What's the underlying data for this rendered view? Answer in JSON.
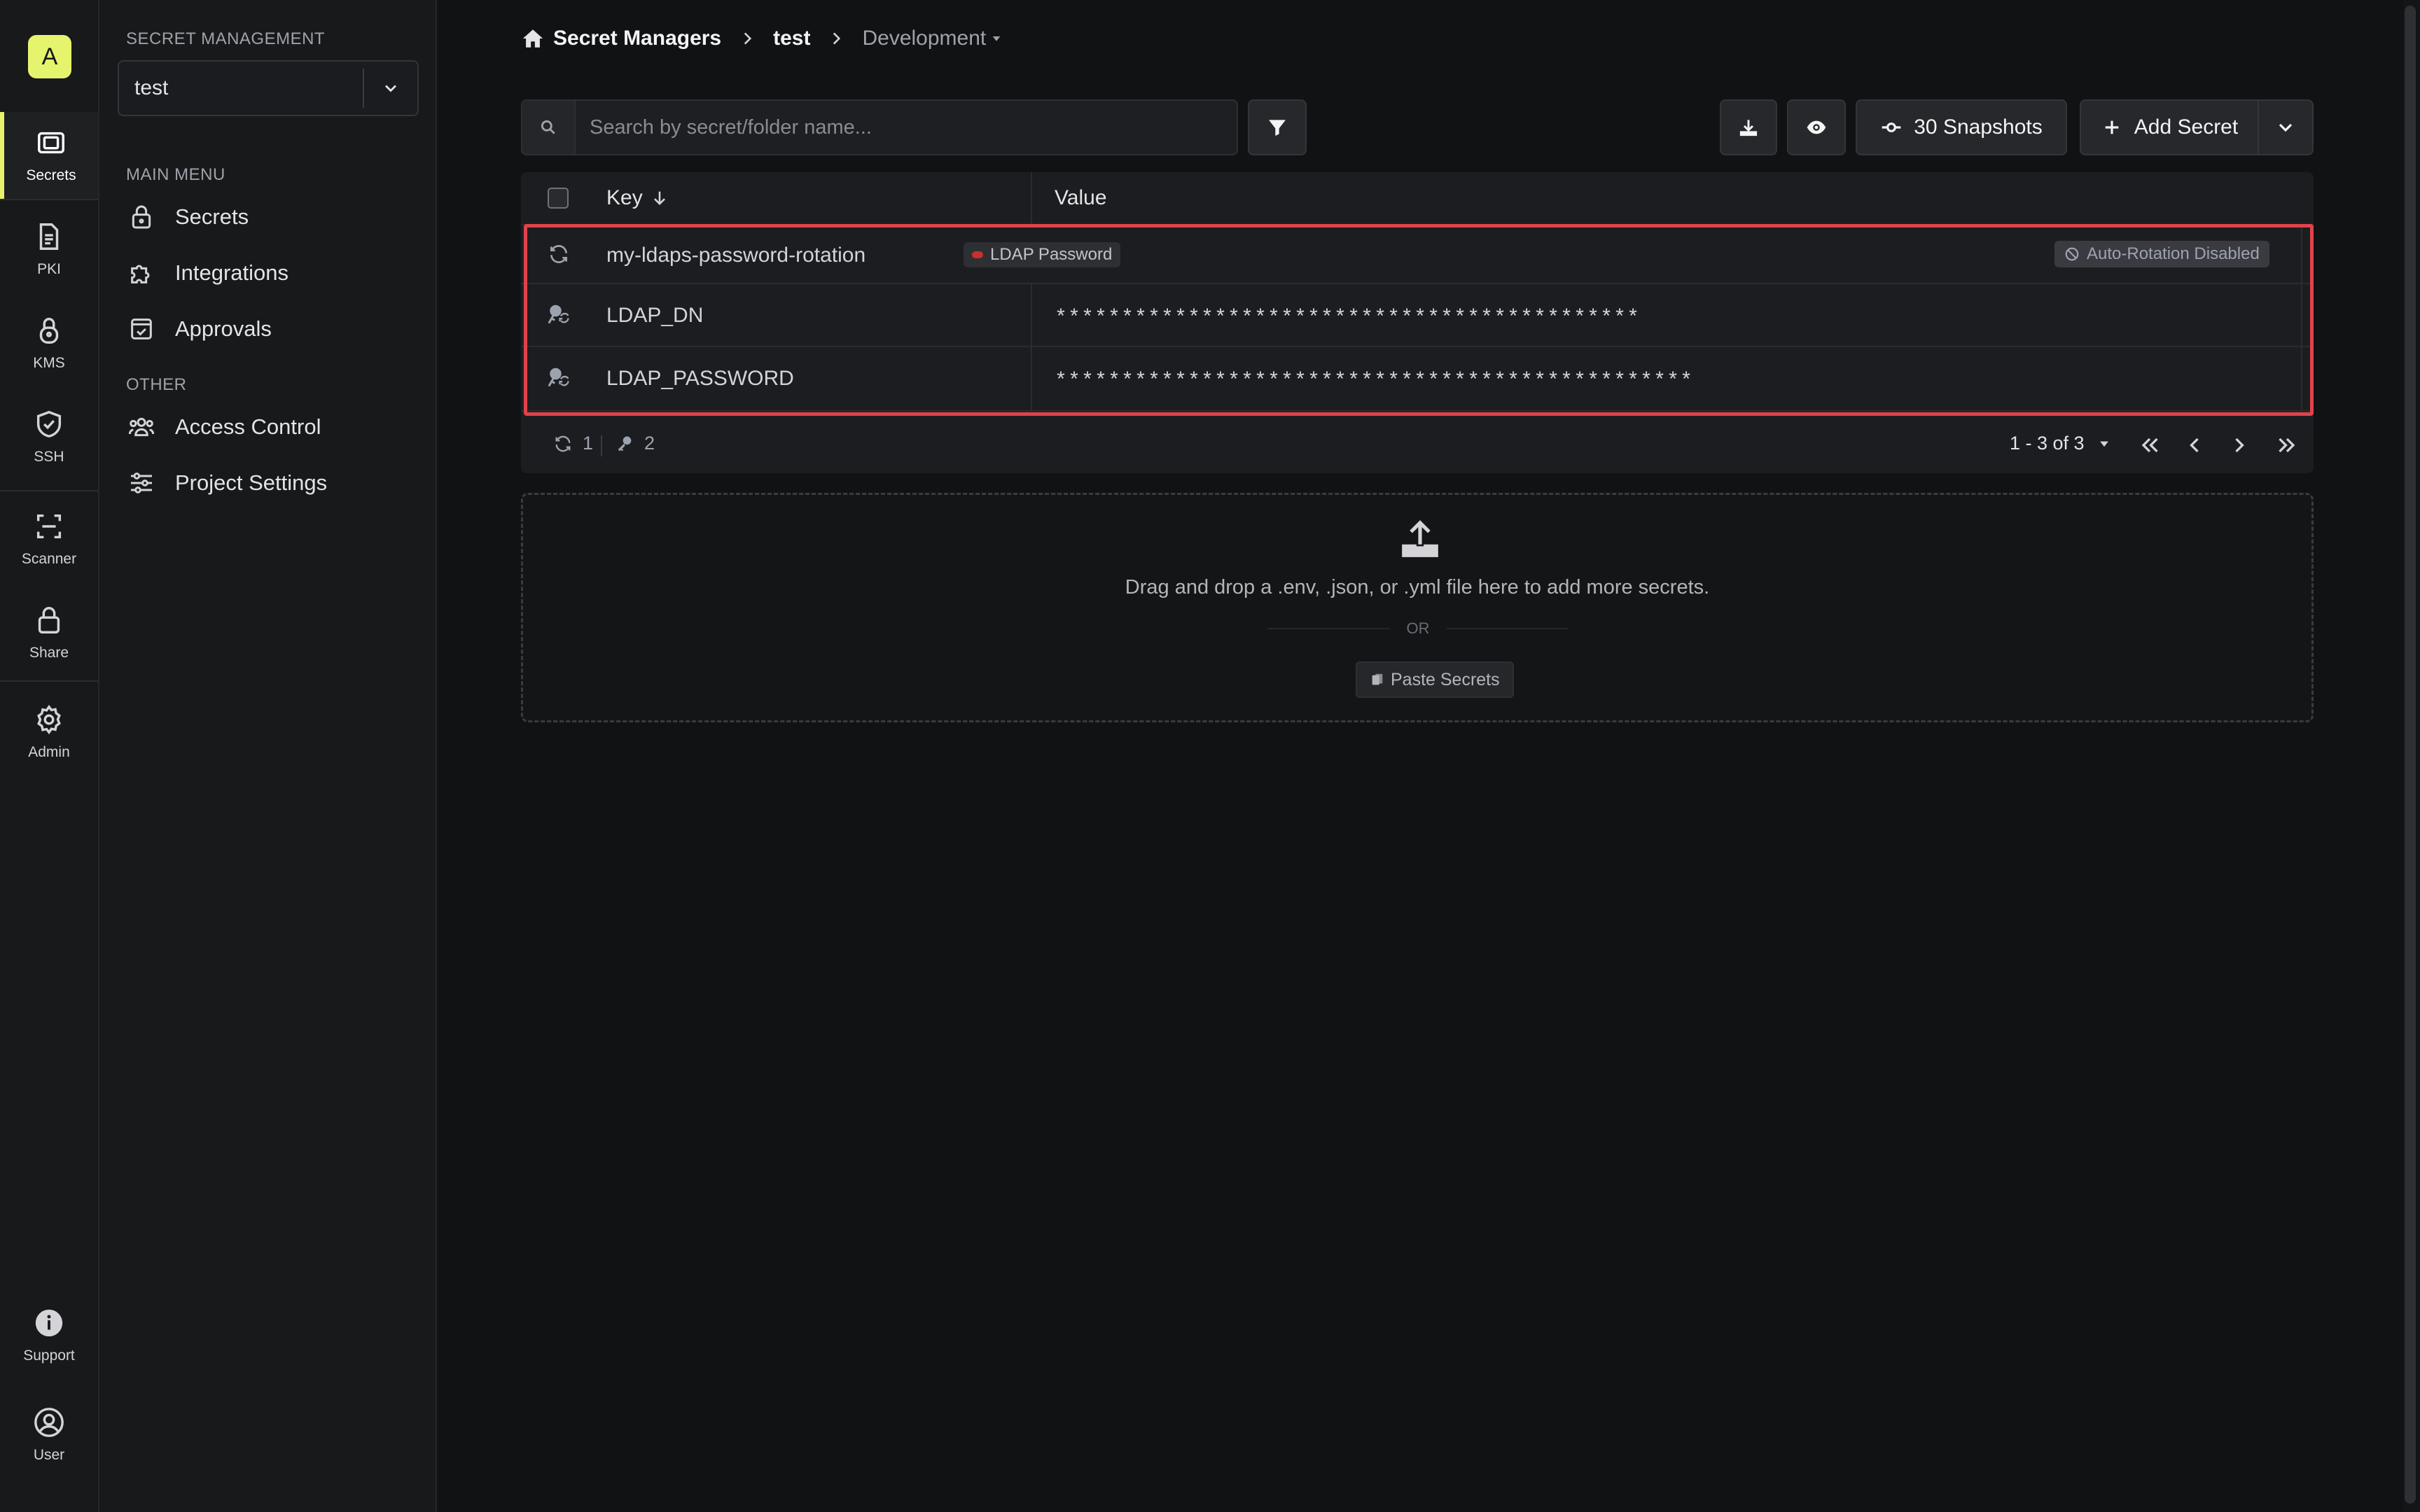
{
  "rail": {
    "avatar_letter": "A",
    "items": [
      {
        "label": "Secrets",
        "icon": "vault-icon"
      },
      {
        "label": "PKI",
        "icon": "document-icon"
      },
      {
        "label": "KMS",
        "icon": "lock-icon"
      },
      {
        "label": "SSH",
        "icon": "shield-icon"
      },
      {
        "label": "Scanner",
        "icon": "scan-icon"
      },
      {
        "label": "Share",
        "icon": "lock-icon"
      },
      {
        "label": "Admin",
        "icon": "gear-icon"
      }
    ],
    "bottom": [
      {
        "label": "Support",
        "icon": "info-icon"
      },
      {
        "label": "User",
        "icon": "user-icon"
      }
    ]
  },
  "sidebar": {
    "title": "SECRET MANAGEMENT",
    "project": "test",
    "main_menu_title": "MAIN MENU",
    "main_menu": [
      {
        "label": "Secrets",
        "icon": "lock-icon"
      },
      {
        "label": "Integrations",
        "icon": "puzzle-icon"
      },
      {
        "label": "Approvals",
        "icon": "approval-icon"
      }
    ],
    "other_title": "OTHER",
    "other_menu": [
      {
        "label": "Access Control",
        "icon": "users-icon"
      },
      {
        "label": "Project Settings",
        "icon": "sliders-icon"
      }
    ]
  },
  "breadcrumb": {
    "root": "Secret Managers",
    "project": "test",
    "environment": "Development"
  },
  "toolbar": {
    "search_placeholder": "Search by secret/folder name...",
    "snapshots_label": "30 Snapshots",
    "add_secret_label": "Add Secret"
  },
  "table": {
    "headers": {
      "key": "Key",
      "value": "Value"
    },
    "rows": [
      {
        "type": "rotation",
        "key": "my-ldaps-password-rotation",
        "tag": "LDAP Password",
        "status": "Auto-Rotation Disabled",
        "value": ""
      },
      {
        "type": "secret",
        "key": "LDAP_DN",
        "value": "********************************************"
      },
      {
        "type": "secret",
        "key": "LDAP_PASSWORD",
        "value": "************************************************"
      }
    ],
    "footer": {
      "rotation_count": "1",
      "secret_count": "2",
      "pagination": "1 - 3 of 3"
    }
  },
  "dropzone": {
    "text": "Drag and drop a .env, .json, or .yml file here to add more secrets.",
    "or": "OR",
    "paste_label": "Paste Secrets"
  },
  "colors": {
    "accent": "#e5f46c",
    "highlight": "#e0434b",
    "background": "#111214"
  }
}
